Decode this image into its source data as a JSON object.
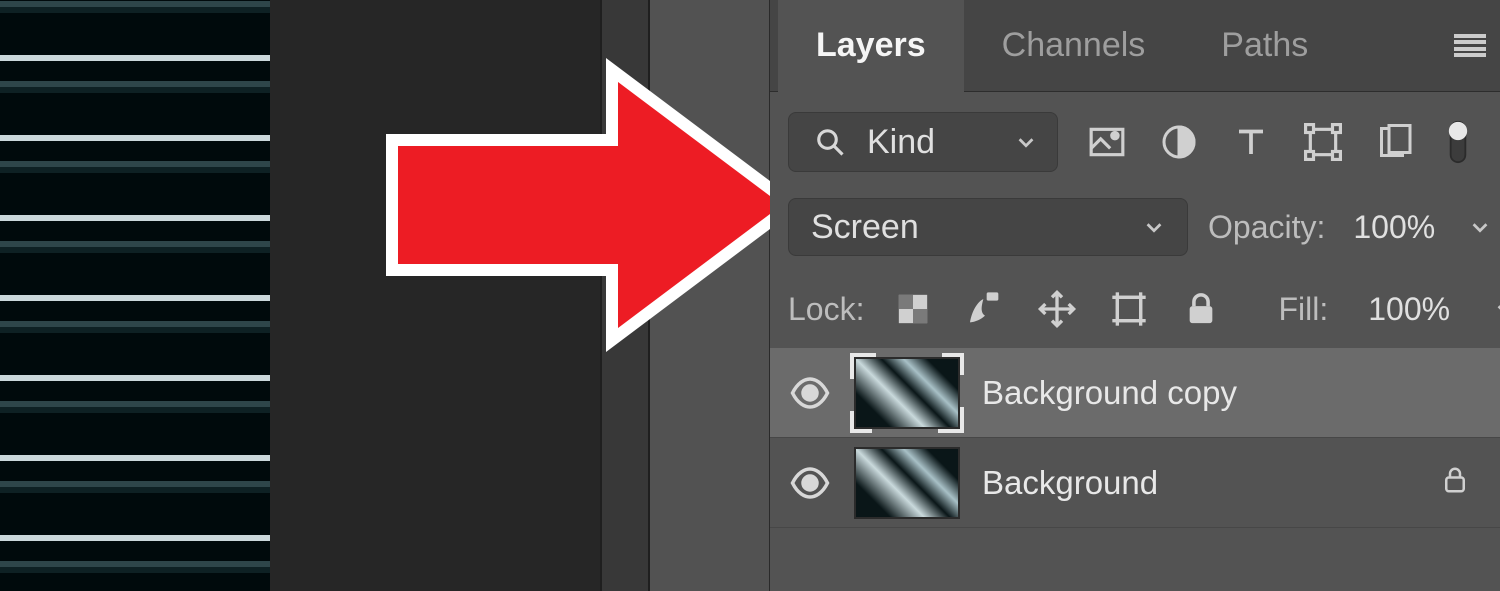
{
  "tabs": {
    "layers": "Layers",
    "channels": "Channels",
    "paths": "Paths"
  },
  "filter": {
    "kind_label": "Kind"
  },
  "blend": {
    "mode": "Screen",
    "opacity_label": "Opacity:",
    "opacity_value": "100%"
  },
  "lock": {
    "label": "Lock:",
    "fill_label": "Fill:",
    "fill_value": "100%"
  },
  "layers": [
    {
      "name": "Background copy",
      "selected": true,
      "locked": false
    },
    {
      "name": "Background",
      "selected": false,
      "locked": true
    }
  ]
}
